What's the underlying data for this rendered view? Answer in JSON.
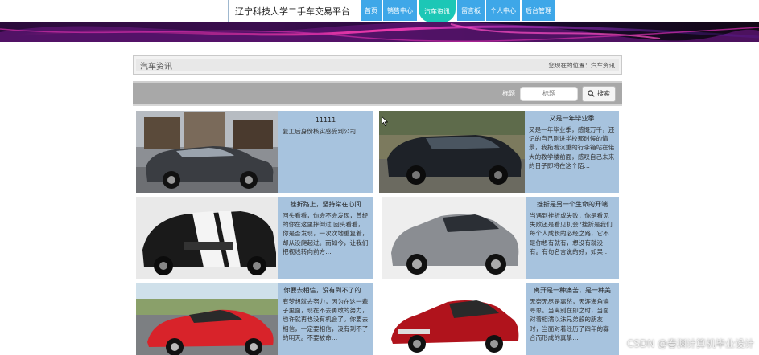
{
  "header": {
    "site_title": "辽宁科技大学二手车交易平台",
    "nav": [
      {
        "label": "首页",
        "active": false
      },
      {
        "label": "销售中心",
        "active": false
      },
      {
        "label": "汽车资讯",
        "active": true
      },
      {
        "label": "留言板",
        "active": false
      },
      {
        "label": "个人中心",
        "active": false
      },
      {
        "label": "后台管理",
        "active": false
      }
    ]
  },
  "breadcrumb": {
    "title": "汽车资讯",
    "path": "您现在的位置：汽车资讯"
  },
  "search": {
    "label": "标题",
    "placeholder": "标题",
    "button_label": "搜索"
  },
  "news": [
    {
      "title": "11111",
      "text": "复工后身份核实感受到公司",
      "car_color": "#3a3d42",
      "bg": "scene-city"
    },
    {
      "title": "又是一年毕业季",
      "text": "又是一年毕业季，感慨万千，还记的自己刚进学校那时候的情景，我拖着沉重的行李箱站在偌大的教学楼前面，感叹自己未来的日子即将在这个陌…",
      "car_color": "#1e2228",
      "bg": "scene-road"
    },
    {
      "title": "挫折路上，坚持常在心间",
      "text": "回头看看，你会不会发现，曾经的你在这里摔倒过 回头看看，你是否发现，一次次地重复着，却从没爬起过。而如今，让我们把视线转向前方…",
      "car_color": "#1a1a1a",
      "bg": "scene-studio"
    },
    {
      "title": "挫折是另一个生命的开端",
      "text": "当遇到挫折或失败，你是看见失败还是看见机会?挫折是我们每个人成长的必经之路，它不是你想有就有，想没有就没有。有句名言说的好，如果…",
      "car_color": "#8a8d92",
      "bg": "scene-studio2"
    },
    {
      "title": "你要去相信，没有到不了的…",
      "text": "有梦想就去努力，因为在这一辈子里面，现在不去勇敢的努力，也许就再也没有机会了。你要去相信，一定要相信，没有到不了的明天。不要被命…",
      "car_color": "#d8232a",
      "bg": "scene-track"
    },
    {
      "title": "离开是一种痛苦，是一种美",
      "text": "无奈无尽是离愁，天涯海角遍寻思。当离别在即之时，当面对着相濡以沫兄弟般的朋友时，当面对着经历了四年的寡合而形成的真挚…",
      "car_color": "#b0131c",
      "bg": "scene-white"
    }
  ],
  "watermark": "CSDN @春渊计算机毕业设计",
  "colors": {
    "nav_blue": "#3ea7e8",
    "nav_active": "#1cc7b6",
    "card_body": "#a7c3de"
  }
}
